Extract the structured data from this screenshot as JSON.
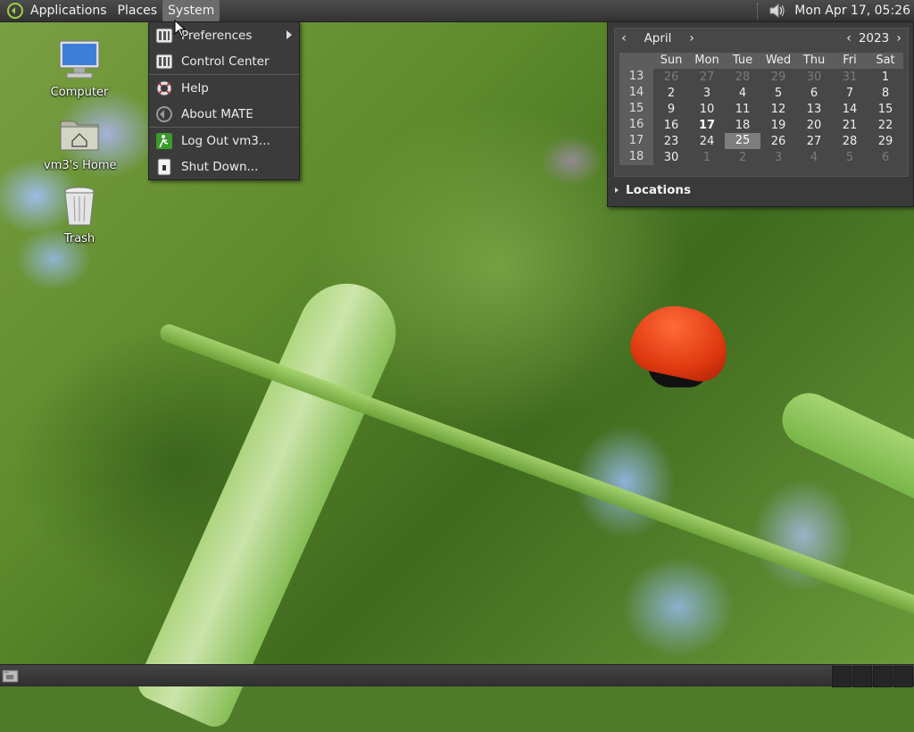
{
  "panel": {
    "menus": [
      "Applications",
      "Places",
      "System"
    ],
    "clock": "Mon Apr 17, 05:26"
  },
  "desktop": {
    "icons": [
      {
        "label": "Computer",
        "icon": "computer-icon"
      },
      {
        "label": "vm3's Home",
        "icon": "home-folder-icon"
      },
      {
        "label": "Trash",
        "icon": "trash-icon"
      }
    ]
  },
  "system_menu": {
    "items": [
      {
        "label": "Preferences",
        "icon": "preferences-icon",
        "submenu": true
      },
      {
        "label": "Control Center",
        "icon": "control-center-icon"
      },
      {
        "label": "Help",
        "icon": "help-icon"
      },
      {
        "label": "About MATE",
        "icon": "mate-logo-icon"
      },
      {
        "label": "Log Out vm3...",
        "icon": "logout-icon"
      },
      {
        "label": "Shut Down...",
        "icon": "shutdown-icon"
      }
    ]
  },
  "calendar": {
    "month": "April",
    "year": "2023",
    "weekdays": [
      "Sun",
      "Mon",
      "Tue",
      "Wed",
      "Thu",
      "Fri",
      "Sat"
    ],
    "weeks": [
      {
        "week": "13",
        "days": [
          "26",
          "27",
          "28",
          "29",
          "30",
          "31",
          "1"
        ]
      },
      {
        "week": "14",
        "days": [
          "2",
          "3",
          "4",
          "5",
          "6",
          "7",
          "8"
        ]
      },
      {
        "week": "15",
        "days": [
          "9",
          "10",
          "11",
          "12",
          "13",
          "14",
          "15"
        ]
      },
      {
        "week": "16",
        "days": [
          "16",
          "17",
          "18",
          "19",
          "20",
          "21",
          "22"
        ]
      },
      {
        "week": "17",
        "days": [
          "23",
          "24",
          "25",
          "26",
          "27",
          "28",
          "29"
        ]
      },
      {
        "week": "18",
        "days": [
          "30",
          "1",
          "2",
          "3",
          "4",
          "5",
          "6"
        ]
      }
    ],
    "today": "17",
    "selected": "25",
    "locations_label": "Locations"
  }
}
